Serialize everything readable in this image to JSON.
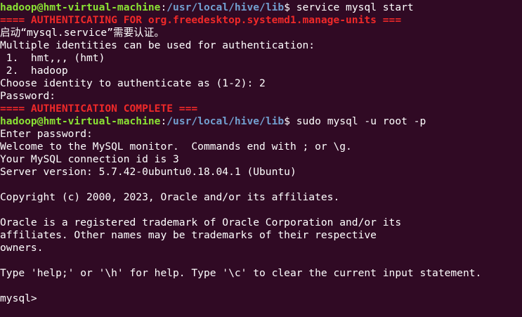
{
  "window": {
    "prompt_user_host": "hadoop@hmt-virtual-machine",
    "prompt_colon": ":",
    "prompt_path": "/usr/local/hive/lib",
    "prompt_suffix": "$ "
  },
  "colors": {
    "background": "#300a24",
    "prompt_user": "#8ae234",
    "prompt_path": "#729fcf",
    "auth_banner": "#ef2929",
    "text": "#ffffff"
  },
  "lines": [
    {
      "kind": "prompt",
      "command": "service mysql start"
    },
    {
      "kind": "red",
      "text": "==== AUTHENTICATING FOR org.freedesktop.systemd1.manage-units ==="
    },
    {
      "kind": "text",
      "text": "启动“mysql.service”需要认证。"
    },
    {
      "kind": "text",
      "text": "Multiple identities can be used for authentication:"
    },
    {
      "kind": "text",
      "text": " 1.  hmt,,, (hmt)"
    },
    {
      "kind": "text",
      "text": " 2.  hadoop"
    },
    {
      "kind": "text",
      "text": "Choose identity to authenticate as (1-2): 2"
    },
    {
      "kind": "text",
      "text": "Password: "
    },
    {
      "kind": "red",
      "text": "==== AUTHENTICATION COMPLETE ==="
    },
    {
      "kind": "prompt",
      "command": "sudo mysql -u root -p"
    },
    {
      "kind": "text",
      "text": "Enter password: "
    },
    {
      "kind": "text",
      "text": "Welcome to the MySQL monitor.  Commands end with ; or \\g."
    },
    {
      "kind": "text",
      "text": "Your MySQL connection id is 3"
    },
    {
      "kind": "text",
      "text": "Server version: 5.7.42-0ubuntu0.18.04.1 (Ubuntu)"
    },
    {
      "kind": "text",
      "text": ""
    },
    {
      "kind": "text",
      "text": "Copyright (c) 2000, 2023, Oracle and/or its affiliates."
    },
    {
      "kind": "text",
      "text": ""
    },
    {
      "kind": "text",
      "text": "Oracle is a registered trademark of Oracle Corporation and/or its"
    },
    {
      "kind": "text",
      "text": "affiliates. Other names may be trademarks of their respective"
    },
    {
      "kind": "text",
      "text": "owners."
    },
    {
      "kind": "text",
      "text": ""
    },
    {
      "kind": "text",
      "text": "Type 'help;' or '\\h' for help. Type '\\c' to clear the current input statement."
    },
    {
      "kind": "text",
      "text": ""
    },
    {
      "kind": "input",
      "text": "mysql> "
    }
  ]
}
